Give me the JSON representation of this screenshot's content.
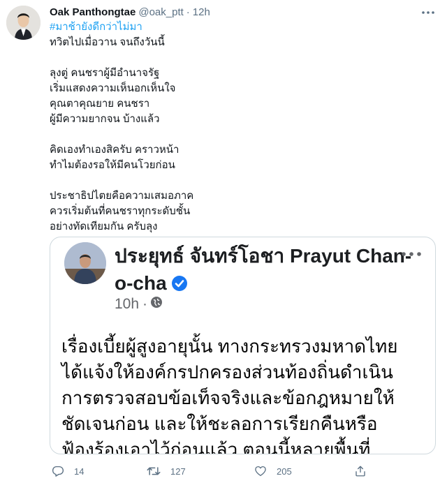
{
  "tweet": {
    "display_name": "Oak Panthongtae",
    "handle": "@oak_ptt",
    "separator": "·",
    "time": "12h",
    "hashtag": "#มาช้ายังดีกว่าไม่มา",
    "lines": [
      "ทวิตไปเมื่อวาน จนถึงวันนี้",
      "",
      "ลุงตู่ คนชราผู้มีอำนาจรัฐ",
      "เริ่มแสดงความเห็นอกเห็นใจ",
      "คุณตาคุณยาย คนชรา",
      "ผู้มีความยากจน บ้างแล้ว",
      "",
      "คิดเองทำเองสิครับ คราวหน้า",
      "ทำไมต้องรอให้มีคนโวยก่อน",
      "",
      "ประชาธิปไตยคือความเสมอภาค",
      "ควรเริ่มต้นที่คนชราทุกระดับชั้น",
      "อย่างทัดเทียมกัน ครับลุง"
    ]
  },
  "embedded_post": {
    "name": "ประยุทธ์ จันทร์โอชา Prayut Chan-o-cha",
    "time": "10h",
    "separator": "·",
    "lines": [
      "เรื่องเบี้ยผู้สูงอายุนั้น ทางกระทรวงมหาดไทย",
      "ได้แจ้งให้องค์กรปกครองส่วนท้องถิ่นดำเนิน",
      "การตรวจสอบข้อเท็จจริงและข้อกฎหมายให้",
      "ชัดเจนก่อน และให้ชะลอการเรียกคืนหรือ",
      "ฟ้องร้องเอาไว้ก่อนแล้ว ตอนนี้หลายพื้นที่"
    ]
  },
  "actions": {
    "replies": "14",
    "retweets": "127",
    "likes": "205"
  },
  "colors": {
    "accent": "#1da1f2",
    "secondary_text": "#5b7083",
    "verified": "#1877f2"
  }
}
